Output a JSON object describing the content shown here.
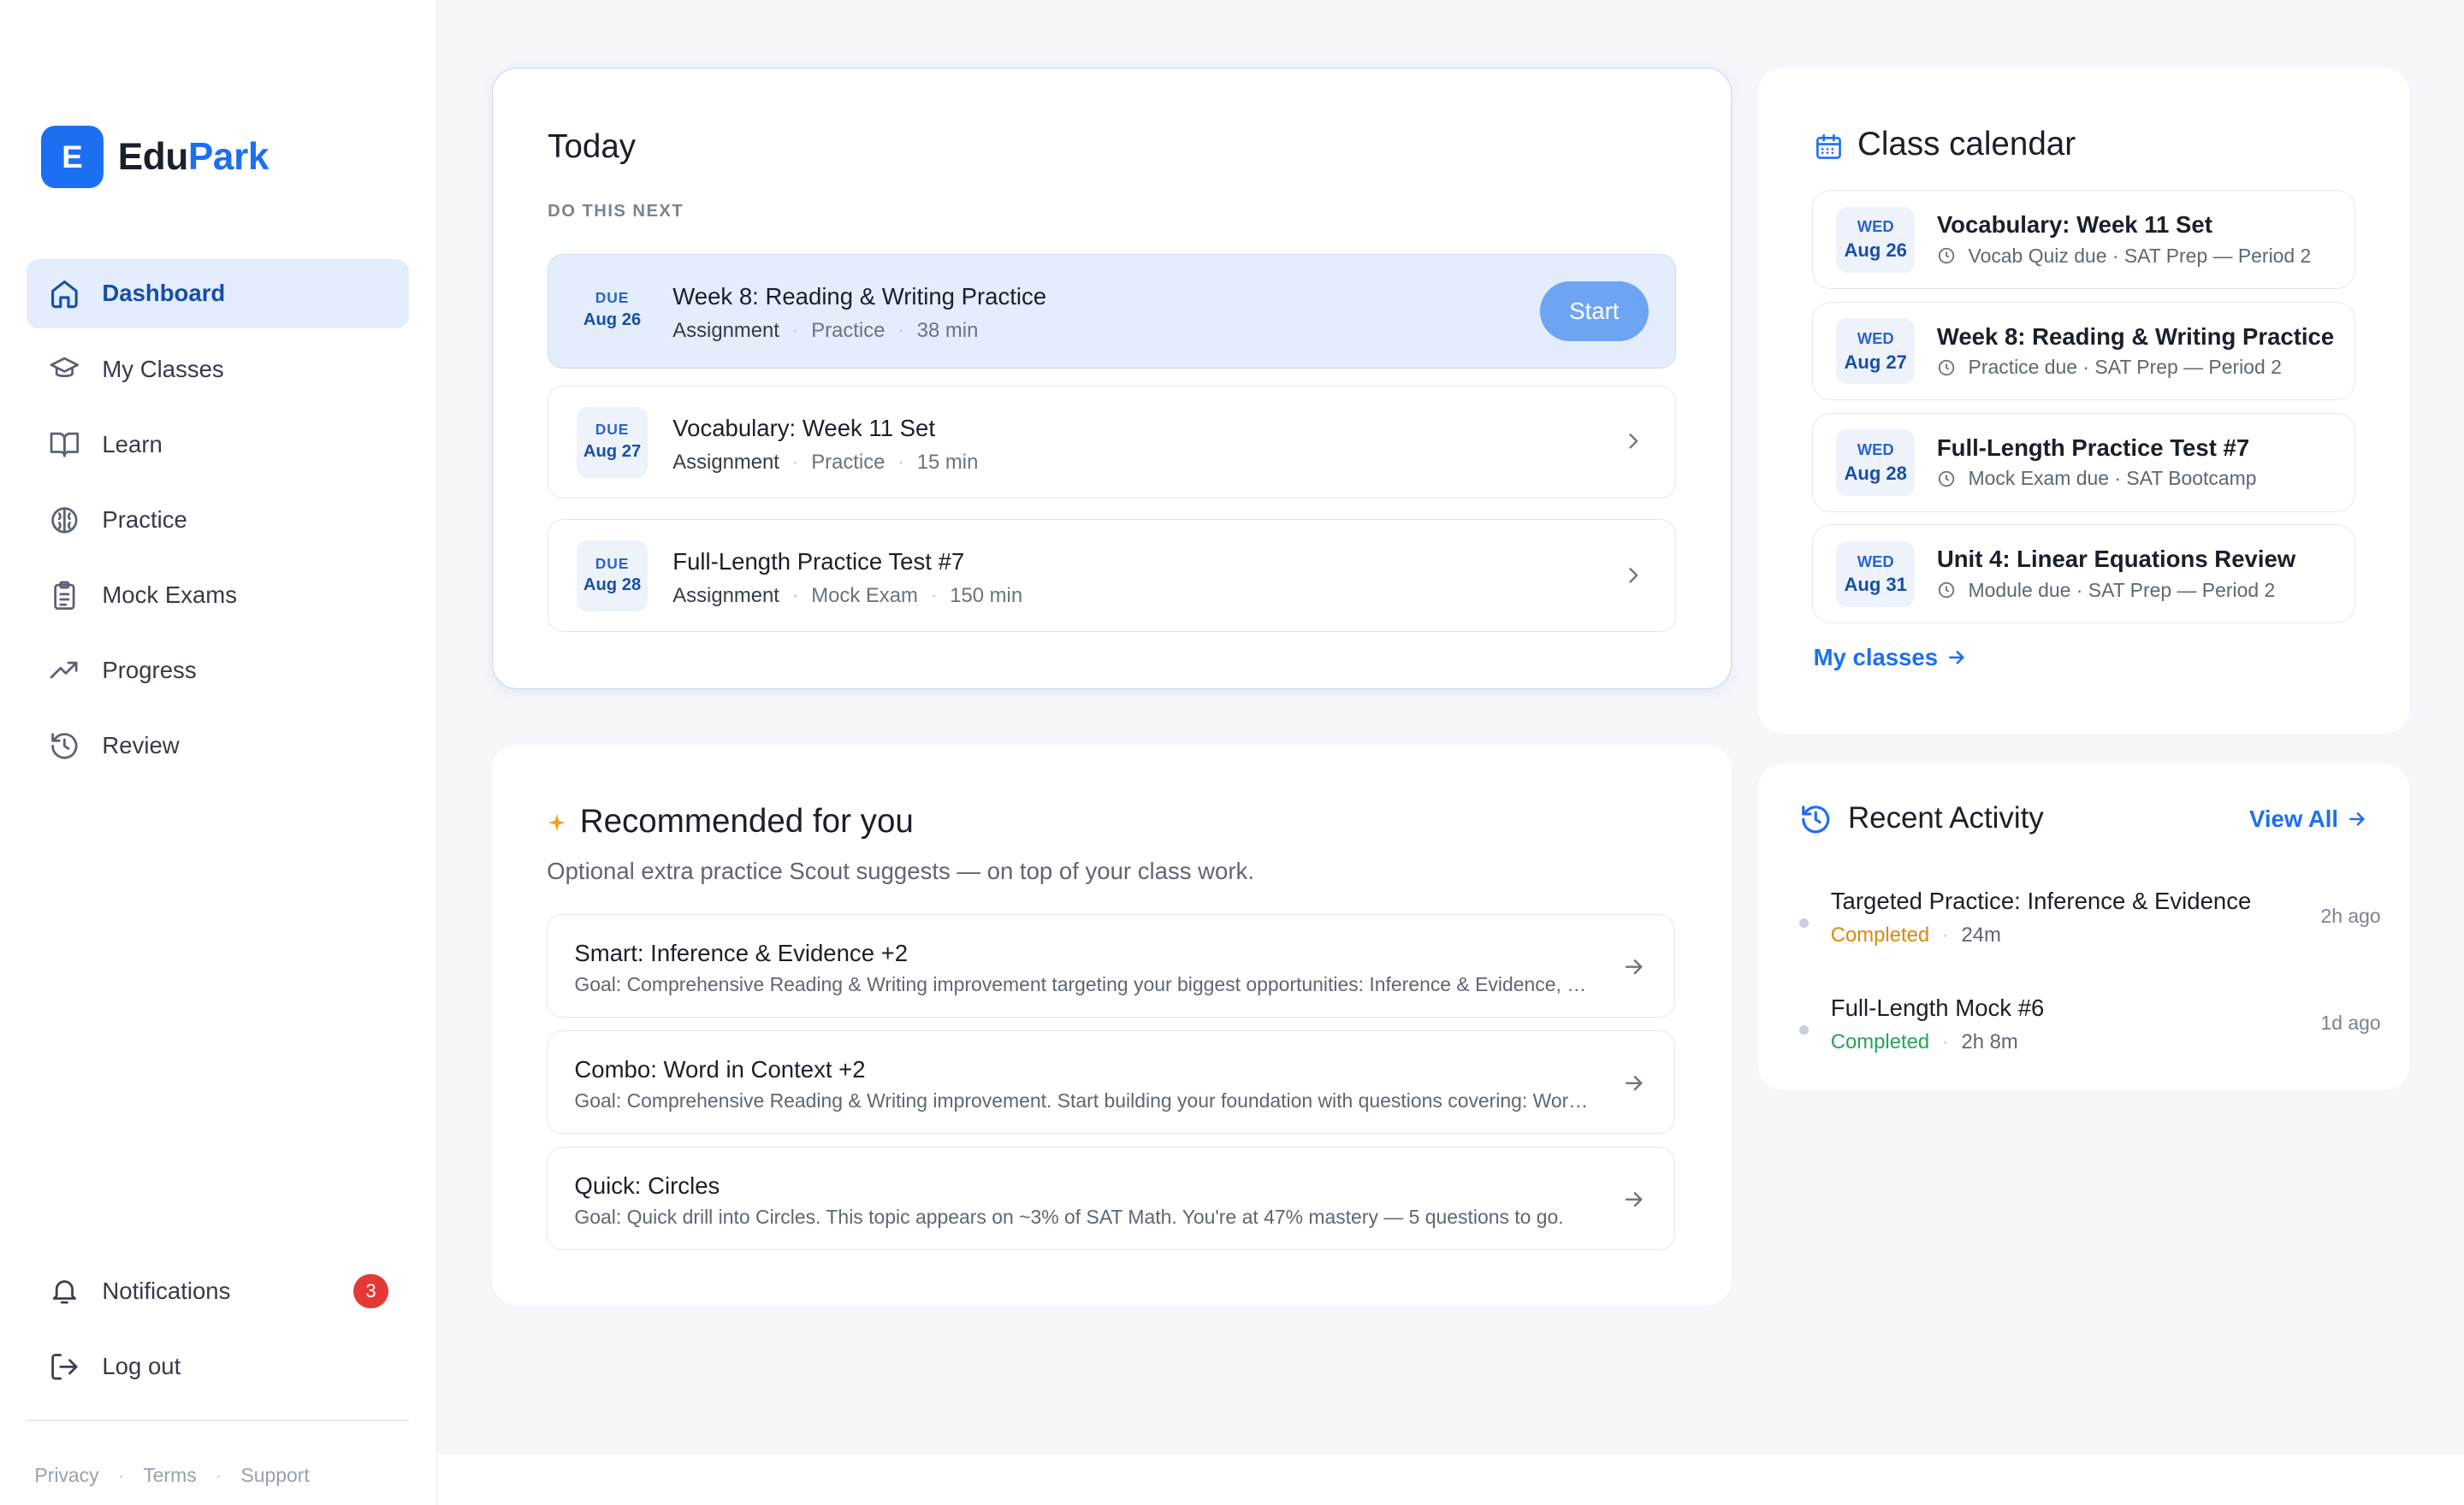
{
  "brand": {
    "letter": "E",
    "name_a": "Edu",
    "name_b": "Park"
  },
  "nav": [
    {
      "label": "Dashboard",
      "icon": "home-icon"
    },
    {
      "label": "My Classes",
      "icon": "graduation-cap-icon"
    },
    {
      "label": "Learn",
      "icon": "book-open-icon"
    },
    {
      "label": "Practice",
      "icon": "brain-icon"
    },
    {
      "label": "Mock Exams",
      "icon": "clipboard-icon"
    },
    {
      "label": "Progress",
      "icon": "trending-up-icon"
    },
    {
      "label": "Review",
      "icon": "history-icon"
    }
  ],
  "bottom_nav": {
    "notifications": "Notifications",
    "notif_count": "3",
    "logout": "Log out"
  },
  "footer": {
    "privacy": "Privacy",
    "terms": "Terms",
    "support": "Support",
    "dot": "·"
  },
  "today": {
    "title": "Today",
    "subhead": "DO THIS NEXT",
    "start": "Start",
    "tasks": [
      {
        "due_label": "DUE",
        "due_date": "Aug 26",
        "title": "Week 8: Reading & Writing Practice",
        "kind": "Assignment",
        "type": "Practice",
        "duration": "38 min"
      },
      {
        "due_label": "DUE",
        "due_date": "Aug 27",
        "title": "Vocabulary: Week 11 Set",
        "kind": "Assignment",
        "type": "Practice",
        "duration": "15 min"
      },
      {
        "due_label": "DUE",
        "due_date": "Aug 28",
        "title": "Full-Length Practice Test #7",
        "kind": "Assignment",
        "type": "Mock Exam",
        "duration": "150 min"
      }
    ]
  },
  "recommended": {
    "title": "Recommended for you",
    "subtitle": "Optional extra practice Scout suggests — on top of your class work.",
    "items": [
      {
        "title": "Smart: Inference & Evidence +2",
        "desc": "Goal: Comprehensive Reading & Writing improvement targeting your biggest opportunities: Inference & Evidence, Word in Context, and more."
      },
      {
        "title": "Combo: Word in Context +2",
        "desc": "Goal: Comprehensive Reading & Writing improvement. Start building your foundation with questions covering: Word in Context and more."
      },
      {
        "title": "Quick: Circles",
        "desc": "Goal: Quick drill into Circles. This topic appears on ~3% of SAT Math. You're at 47% mastery — 5 questions to go."
      }
    ]
  },
  "calendar": {
    "title": "Class calendar",
    "events": [
      {
        "day": "WED",
        "date": "Aug 26",
        "title": "Vocabulary: Week 11 Set",
        "meta": "Vocab Quiz due · SAT Prep — Period 2"
      },
      {
        "day": "WED",
        "date": "Aug 27",
        "title": "Week 8: Reading & Writing Practice",
        "meta": "Practice due · SAT Prep — Period 2"
      },
      {
        "day": "WED",
        "date": "Aug 28",
        "title": "Full-Length Practice Test #7",
        "meta": "Mock Exam due · SAT Bootcamp"
      },
      {
        "day": "WED",
        "date": "Aug 31",
        "title": "Unit 4: Linear Equations Review",
        "meta": "Module due · SAT Prep — Period 2"
      }
    ],
    "link": "My classes"
  },
  "activity": {
    "title": "Recent Activity",
    "view_all": "View All",
    "items": [
      {
        "title": "Targeted Practice: Inference & Evidence",
        "status": "Completed",
        "duration": "24m",
        "time": "2h ago",
        "status_color": "#d98a10"
      },
      {
        "title": "Full-Length Mock #6",
        "status": "Completed",
        "duration": "2h 8m",
        "time": "1d ago",
        "status_color": "#26a35a"
      }
    ]
  },
  "colors": {
    "accent": "#1d6ff2",
    "active_bg": "#e3edfc",
    "start_button": "#6ea5f2",
    "badge": "#e53935"
  }
}
